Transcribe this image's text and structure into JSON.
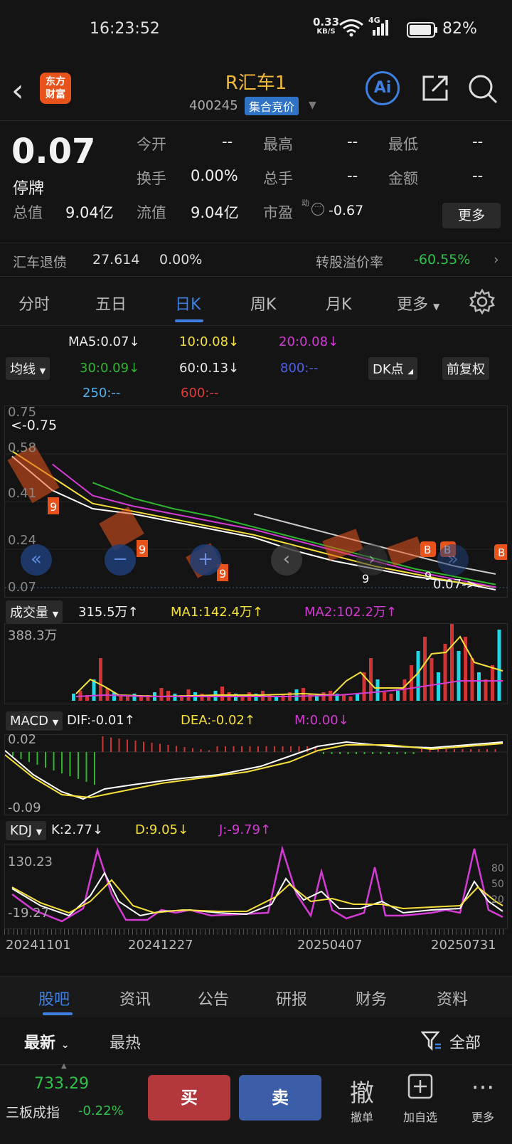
{
  "status": {
    "time": "16:23:52",
    "net_speed": "0.33",
    "net_unit": "KB/S",
    "signal": "4G",
    "battery": "82%"
  },
  "header": {
    "logo_top": "东方",
    "logo_bottom": "财富",
    "title": "R汇车1",
    "code": "400245",
    "tag": "集合竞价",
    "ai_label": "Ai"
  },
  "quote": {
    "price": "0.07",
    "state": "停牌",
    "open_label": "今开",
    "open": "--",
    "high_label": "最高",
    "high": "--",
    "low_label": "最低",
    "low": "--",
    "turnover_label": "换手",
    "turnover": "0.00%",
    "volume_label": "总手",
    "volume": "--",
    "amount_label": "金额",
    "amount": "--",
    "mktcap_label": "总值",
    "mktcap": "9.04亿",
    "float_label": "流值",
    "float": "9.04亿",
    "pe_label": "市盈",
    "pe_sup": "动",
    "pe": "-0.67",
    "more": "更多"
  },
  "bond": {
    "name": "汇车退债",
    "price": "27.614",
    "change": "0.00%",
    "premium_label": "转股溢价率",
    "premium": "-60.55%"
  },
  "tabs": [
    "分时",
    "五日",
    "日K",
    "周K",
    "月K",
    "更多"
  ],
  "ma": {
    "ma5": "MA5:0.07↓",
    "ma10": "10:0.08↓",
    "ma20": "20:0.08↓",
    "ma30": "30:0.09↓",
    "ma60": "60:0.13↓",
    "ma800": "800:--",
    "ma250": "250:--",
    "ma600": "600:--",
    "line_btn": "均线",
    "dk_btn": "DK点",
    "fq_btn": "前复权"
  },
  "kline": {
    "top_label": "0.75",
    "max_mark": "<-0.75",
    "y2": "0.58",
    "y3": "0.41",
    "y4": "0.24",
    "y5": "0.07",
    "last_mark": "0.07->"
  },
  "volume": {
    "btn": "成交量",
    "vol": "315.5万↑",
    "ma1": "MA1:142.4万↑",
    "ma2": "MA2:102.2万↑",
    "max": "388.3万"
  },
  "macd": {
    "btn": "MACD",
    "dif": "DIF:-0.01↑",
    "dea": "DEA:-0.02↑",
    "m": "M:0.00↓",
    "top": "0.02",
    "bottom": "-0.09"
  },
  "kdj": {
    "btn": "KDJ",
    "k": "K:2.77↓",
    "d": "D:9.05↓",
    "j": "J:-9.79↑",
    "top": "130.23",
    "bottom": "-19.27",
    "r80": "80",
    "r50": "50",
    "r20": "20"
  },
  "dates": [
    "20241101",
    "20241227",
    "20250407",
    "20250731"
  ],
  "subtabs": [
    "股吧",
    "资讯",
    "公告",
    "研报",
    "财务",
    "资料"
  ],
  "filter": {
    "latest": "最新",
    "hot": "最热",
    "all": "全部"
  },
  "bottom": {
    "index_value": "733.29",
    "index_name": "三板成指",
    "index_change": "-0.22%",
    "buy": "买",
    "sell": "卖",
    "cancel": "撤单",
    "watch": "加自选",
    "more": "更多",
    "cancel_glyph": "撤"
  },
  "chart_data": {
    "type": "line",
    "series": [
      {
        "name": "MA5",
        "values": [
          0.58,
          0.45,
          0.38,
          0.36,
          0.33,
          0.3,
          0.27,
          0.22,
          0.18,
          0.15,
          0.12,
          0.1,
          0.07
        ]
      },
      {
        "name": "MA10",
        "values": [
          0.6,
          0.5,
          0.4,
          0.37,
          0.34,
          0.31,
          0.28,
          0.24,
          0.2,
          0.16,
          0.13,
          0.1,
          0.08
        ]
      },
      {
        "name": "MA20",
        "values": [
          null,
          0.55,
          0.43,
          0.39,
          0.36,
          0.33,
          0.3,
          0.26,
          0.22,
          0.18,
          0.14,
          0.11,
          0.08
        ]
      },
      {
        "name": "MA30",
        "values": [
          null,
          null,
          0.48,
          0.42,
          0.38,
          0.35,
          0.31,
          0.27,
          0.23,
          0.19,
          0.15,
          0.12,
          0.09
        ]
      },
      {
        "name": "MA60",
        "values": [
          null,
          null,
          null,
          null,
          null,
          null,
          0.36,
          0.32,
          0.28,
          0.24,
          0.2,
          0.16,
          0.13
        ]
      }
    ],
    "ylim": [
      0.07,
      0.75
    ]
  }
}
